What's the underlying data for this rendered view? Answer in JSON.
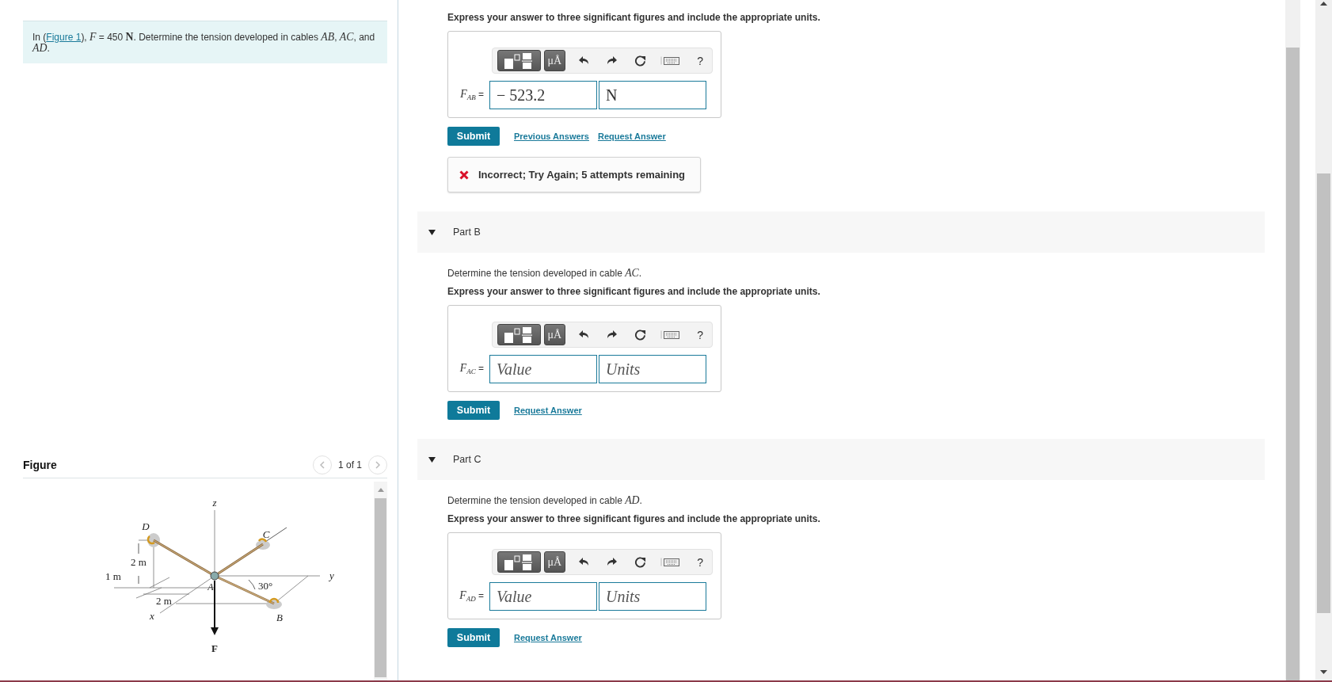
{
  "problem": {
    "prefix": "In (",
    "link": "Figure 1",
    "text": "), *F* = 450 **N**. Determine the tension developed in cables *AB*, *AC*, and *AD*."
  },
  "figure": {
    "heading": "Figure",
    "pager": "1 of 1",
    "labels": {
      "z_axis": "z",
      "y_axis": "y",
      "x_axis": "x",
      "force": "F",
      "point_a": "A",
      "point_b": "B",
      "point_c": "C",
      "point_d": "D",
      "height": "2 m",
      "offset": "1 m",
      "depth": "2 m",
      "angle": "30°"
    }
  },
  "parts": [
    {
      "instruction": "Express your answer to three significant figures and include the appropriate units.",
      "toolbar": {
        "units": "μÅ",
        "help": "?"
      },
      "label": "*F*$_{AB}$ =",
      "value": "− 523.2",
      "unit": "N",
      "submit": "Submit",
      "links": [
        "Previous Answers",
        "Request Answer"
      ],
      "feedback": "Incorrect; Try Again; 5 attempts remaining"
    },
    {
      "title": "Part B",
      "expanded": true,
      "question": "Determine the tension developed in cable *AC*.",
      "instruction": "Express your answer to three significant figures and include the appropriate units.",
      "toolbar": {
        "units": "μÅ",
        "help": "?"
      },
      "label": "*F*$_{AC}$ =",
      "value_placeholder": "Value",
      "unit_placeholder": "Units",
      "submit": "Submit",
      "links": [
        "Request Answer"
      ]
    },
    {
      "title": "Part C",
      "expanded": true,
      "question": "Determine the tension developed in cable *AD*.",
      "instruction": "Express your answer to three significant figures and include the appropriate units.",
      "toolbar": {
        "units": "μÅ",
        "help": "?"
      },
      "label": "*F*$_{AD}$ =",
      "value_placeholder": "Value",
      "unit_placeholder": "Units",
      "submit": "Submit",
      "links": [
        "Request Answer"
      ]
    }
  ]
}
